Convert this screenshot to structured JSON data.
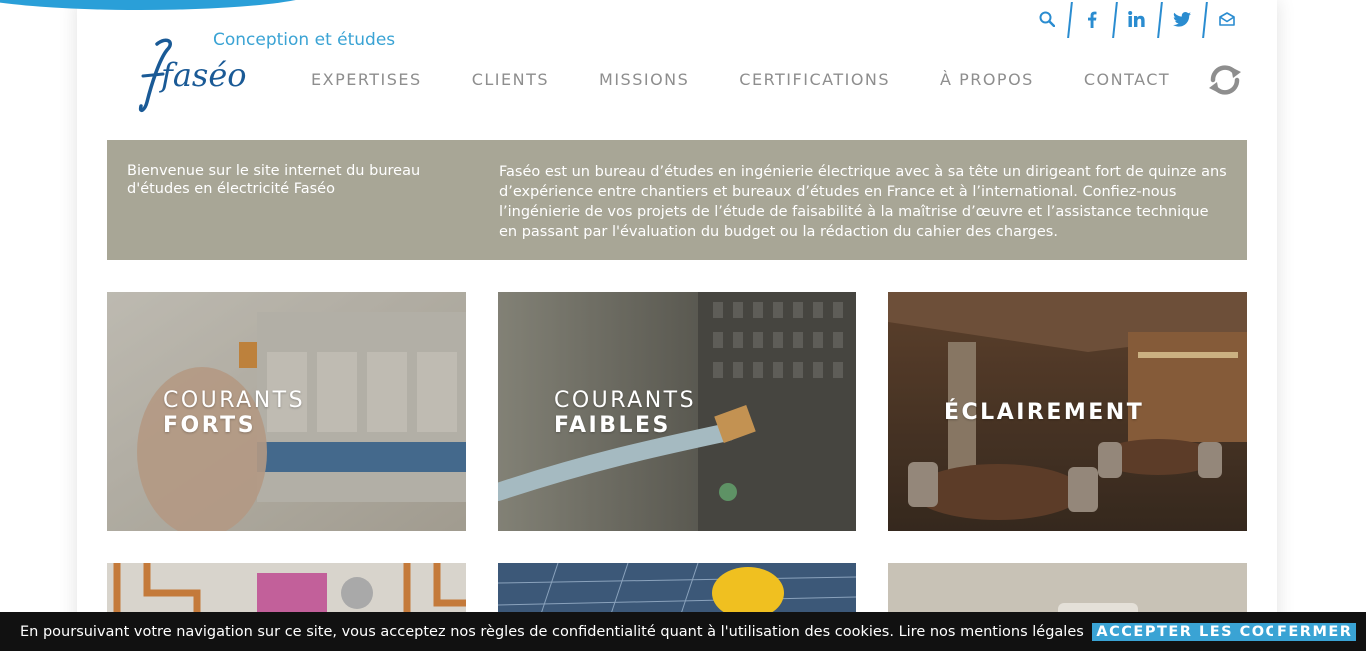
{
  "brand": {
    "logo_text": "faséo",
    "tagline": "Conception et études"
  },
  "social": [
    {
      "icon": "search-icon",
      "glyph": "⚲"
    },
    {
      "icon": "facebook-icon",
      "glyph": "f"
    },
    {
      "icon": "linkedin-icon",
      "glyph": "in"
    },
    {
      "icon": "twitter-icon",
      "glyph": "🐦"
    },
    {
      "icon": "mail-icon",
      "glyph": "✉"
    }
  ],
  "nav": {
    "items": [
      "EXPERTISES",
      "CLIENTS",
      "MISSIONS",
      "CERTIFICATIONS",
      "À PROPOS",
      "CONTACT"
    ]
  },
  "intro": {
    "left": "Bienvenue sur le site internet du bureau d'études en électricité Faséo",
    "right": "Faséo est un bureau d’études en ingénierie électrique avec à sa tête un dirigeant fort de quinze ans d’expérience entre chantiers et bureaux d’études en France et à l’international. Confiez-nous l’ingénierie de vos projets de l’étude de faisabilité à la maîtrise d’œuvre et l’assistance technique en passant par l'évaluation du budget ou la rédaction du cahier des charges."
  },
  "tiles": [
    {
      "line1": "COURANTS",
      "line2": "FORTS"
    },
    {
      "line1": "COURANTS",
      "line2": "FAIBLES"
    },
    {
      "line1": "",
      "line2": "ÉCLAIREMENT"
    }
  ],
  "cookie": {
    "text": "En poursuivant votre navigation sur ce site, vous acceptez nos règles de confidentialité quant à l'utilisation des cookies. Lire nos mentions légales",
    "accept": "ACCEPTER LES COOKIES",
    "close": "FERMER"
  },
  "colors": {
    "accent": "#3aa3d4",
    "logo": "#1a5a96",
    "intro_bg": "#a8a696",
    "nav_text": "#8e8e8e"
  }
}
